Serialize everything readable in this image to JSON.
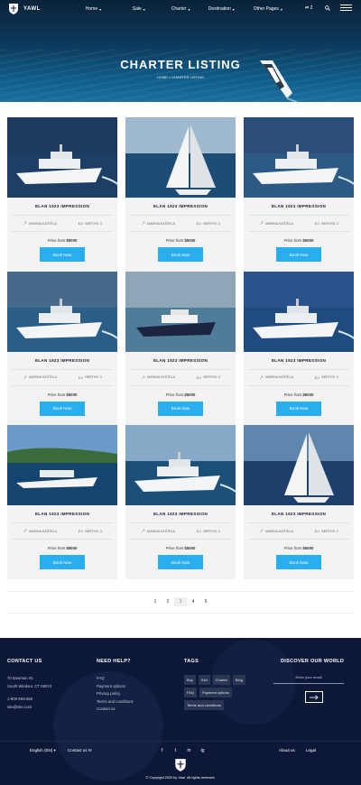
{
  "header": {
    "logo_text": "YAWL",
    "menu": [
      {
        "label": "Home",
        "caret": "▾"
      },
      {
        "label": "Sale",
        "caret": "▾"
      },
      {
        "label": "Charter",
        "caret": "▾"
      },
      {
        "label": "Destination",
        "caret": "▾"
      },
      {
        "label": "Other Pages",
        "caret": "▾"
      }
    ],
    "compare_count": "2"
  },
  "hero": {
    "title": "CHARTER LISTING",
    "breadcrumb_home": "HOME",
    "breadcrumb_sep": "»",
    "breadcrumb_current": "CHARTER LISTING"
  },
  "listings": [
    {
      "title": "ELAN 1923 IMPRESSION",
      "location": "MARINA KAŠTELA",
      "berths": "BERTHS: 3",
      "price_prefix": "Price from",
      "price": "$5000",
      "button": "Book Now"
    },
    {
      "title": "ELAN 1923 IMPRESSION",
      "location": "MARINA KAŠTELA",
      "berths": "BERTHS: 3",
      "price_prefix": "Price from",
      "price": "$5000",
      "button": "Book Now"
    },
    {
      "title": "ELAN 1923 IMPRESSION",
      "location": "MARINA KAŠTELA",
      "berths": "BERTHS: 3",
      "price_prefix": "Price from",
      "price": "$5000",
      "button": "Book Now"
    },
    {
      "title": "ELAN 1923 IMPRESSION",
      "location": "MARINA KAŠTELA",
      "berths": "BERTHS: 3",
      "price_prefix": "Price from",
      "price": "$5000",
      "button": "Book Now"
    },
    {
      "title": "ELAN 1923 IMPRESSION",
      "location": "MARINA KAŠTELA",
      "berths": "BERTHS: 3",
      "price_prefix": "Price from",
      "price": "$5000",
      "button": "Book Now"
    },
    {
      "title": "ELAN 1923 IMPRESSION",
      "location": "MARINA KAŠTELA",
      "berths": "BERTHS: 3",
      "price_prefix": "Price from",
      "price": "$5000",
      "button": "Book Now"
    },
    {
      "title": "ELAN 1923 IMPRESSION",
      "location": "MARINA KAŠTELA",
      "berths": "BERTHS: 3",
      "price_prefix": "Price from",
      "price": "$5000",
      "button": "Book Now"
    },
    {
      "title": "ELAN 1923 IMPRESSION",
      "location": "MARINA KAŠTELA",
      "berths": "BERTHS: 3",
      "price_prefix": "Price from",
      "price": "$5000",
      "button": "Book Now"
    },
    {
      "title": "ELAN 1923 IMPRESSION",
      "location": "MARINA KAŠTELA",
      "berths": "BERTHS: 3",
      "price_prefix": "Price from",
      "price": "$5000",
      "button": "Book Now"
    }
  ],
  "pagination": {
    "pages": [
      "1",
      "2",
      "3",
      "4",
      "5"
    ],
    "current": "3"
  },
  "footer": {
    "contact": {
      "heading": "CONTACT US",
      "address1": "70 Bowman St.",
      "address2": "South Windsor, CT 06074",
      "phone": "1-800-555-555",
      "email": "site@site.com"
    },
    "help": {
      "heading": "NEED HELP?",
      "links": [
        "FAQ",
        "Payment options",
        "Privacy policy",
        "Terms and conditions",
        "Contact us"
      ]
    },
    "tags": {
      "heading": "TAGS",
      "items": [
        "Buy",
        "Sell",
        "Charter",
        "Blog",
        "FAQ",
        "Payment options",
        "Terms and conditions"
      ]
    },
    "newsletter": {
      "heading": "DISCOVER OUR WORLD",
      "placeholder": "Enter your email"
    },
    "language": "English (EN)",
    "contact_link": "Contact us",
    "socials": [
      "f",
      "t",
      "in",
      "ig"
    ],
    "about": "About us",
    "legal": "Legal",
    "copyright": "© Copyright 2020 by Yawl. All rights reserved."
  },
  "colors": {
    "accent": "#2aaef0",
    "footer_bg": "#0d1838",
    "hero_dark": "#0a2238"
  }
}
